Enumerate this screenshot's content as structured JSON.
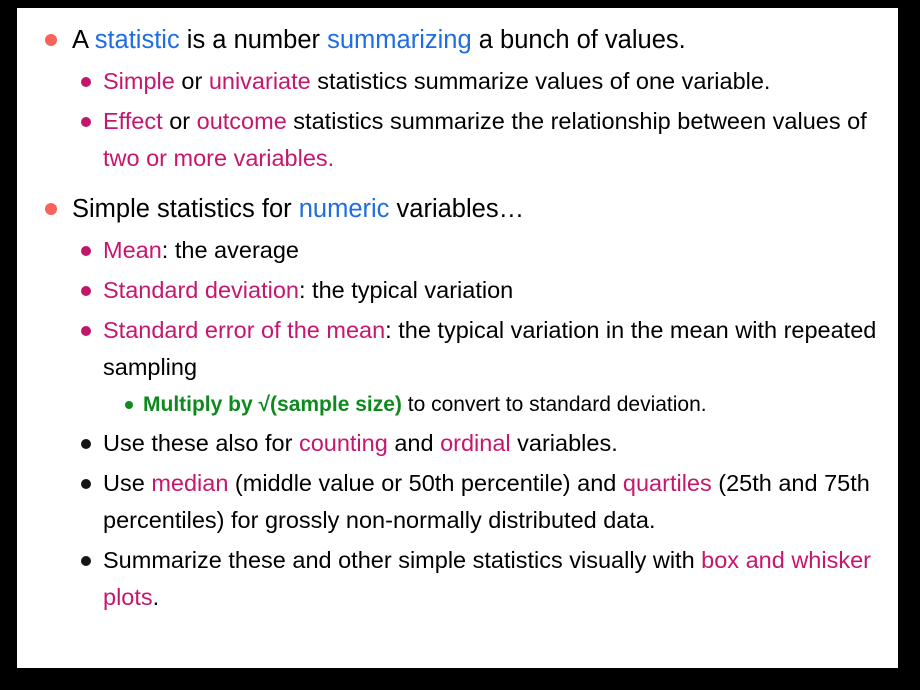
{
  "slide": {
    "background_color": "#000000",
    "canvas_color": "#ffffff",
    "colors": {
      "bullet_level1": "#f8635b",
      "bullet_level2": "#c2156c",
      "bullet_level2_dark": "#151515",
      "bullet_level3": "#108a1f",
      "accent_blue": "#1f6ee0",
      "accent_magenta": "#c5176e",
      "accent_green": "#0d8a1e",
      "text_black": "#000000"
    }
  },
  "bullets": [
    {
      "level": 1,
      "id": "statistic-definition",
      "runs": [
        {
          "text": "A ",
          "color": "black"
        },
        {
          "text": "statistic",
          "color": "blue"
        },
        {
          "text": " is a number ",
          "color": "black"
        },
        {
          "text": "summarizing",
          "color": "blue"
        },
        {
          "text": " a bunch of values.",
          "color": "black"
        }
      ]
    },
    {
      "level": 2,
      "id": "simple-univariate",
      "runs": [
        {
          "text": "Simple",
          "color": "magenta"
        },
        {
          "text": " or ",
          "color": "black"
        },
        {
          "text": "univariate",
          "color": "magenta"
        },
        {
          "text": " statistics summarize values of one variable.",
          "color": "black"
        }
      ]
    },
    {
      "level": 2,
      "id": "effect-outcome",
      "runs": [
        {
          "text": "Effect",
          "color": "magenta"
        },
        {
          "text": " or ",
          "color": "black"
        },
        {
          "text": "outcome",
          "color": "magenta"
        },
        {
          "text": " statistics summarize the relationship between values of ",
          "color": "black"
        },
        {
          "text": "two or more variables.",
          "color": "magenta"
        }
      ]
    },
    {
      "level": 1,
      "id": "simple-statistics-numeric",
      "runs": [
        {
          "text": "Simple statistics for ",
          "color": "black"
        },
        {
          "text": "numeric",
          "color": "blue"
        },
        {
          "text": " variables…",
          "color": "black"
        }
      ]
    },
    {
      "level": 2,
      "id": "mean",
      "runs": [
        {
          "text": "Mean",
          "color": "magenta"
        },
        {
          "text": ": the average",
          "color": "black"
        }
      ]
    },
    {
      "level": 2,
      "id": "standard-deviation",
      "runs": [
        {
          "text": "Standard deviation",
          "color": "magenta"
        },
        {
          "text": ": the typical variation",
          "color": "black"
        }
      ]
    },
    {
      "level": 2,
      "id": "standard-error-of-the-mean",
      "runs": [
        {
          "text": "Standard error of the mean",
          "color": "magenta"
        },
        {
          "text": ": the typical variation in the mean with repeated sampling",
          "color": "black"
        }
      ]
    },
    {
      "level": 3,
      "id": "multiply-by-sqrt-sample-size",
      "runs": [
        {
          "text": "Multiply by √(sample size)",
          "color": "green",
          "bold": true
        },
        {
          "text": " to convert to standard deviation.",
          "color": "black"
        }
      ]
    },
    {
      "level": 2,
      "dark_bullet": true,
      "id": "counting-ordinal",
      "runs": [
        {
          "text": "Use these also for ",
          "color": "black"
        },
        {
          "text": "counting",
          "color": "magenta"
        },
        {
          "text": " and ",
          "color": "black"
        },
        {
          "text": "ordinal",
          "color": "magenta"
        },
        {
          "text": " variables.",
          "color": "black"
        }
      ]
    },
    {
      "level": 2,
      "dark_bullet": true,
      "id": "median-quartiles",
      "runs": [
        {
          "text": "Use ",
          "color": "black"
        },
        {
          "text": "median",
          "color": "magenta"
        },
        {
          "text": " (middle value or 50th percentile) and ",
          "color": "black"
        },
        {
          "text": "quartiles",
          "color": "magenta"
        },
        {
          "text": " (25th and 75th percentiles) for grossly non-normally distributed data.",
          "color": "black"
        }
      ]
    },
    {
      "level": 2,
      "dark_bullet": true,
      "id": "box-and-whisker-plots",
      "runs": [
        {
          "text": "Summarize these and other simple statistics visually with ",
          "color": "black"
        },
        {
          "text": "box and whisker plots",
          "color": "magenta"
        },
        {
          "text": ".",
          "color": "black"
        }
      ]
    }
  ]
}
